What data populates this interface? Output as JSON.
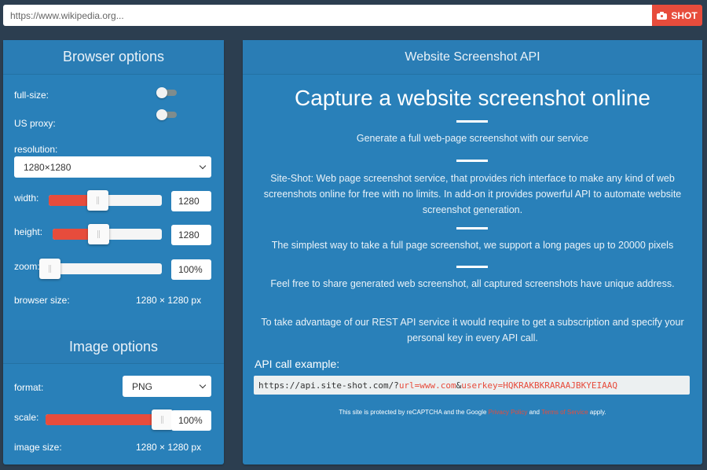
{
  "topbar": {
    "url_placeholder": "https://www.wikipedia.org...",
    "url_value": "",
    "shot_label": "SHOT",
    "shot_icon": "camera-icon"
  },
  "browser_options": {
    "title": "Browser options",
    "full_size": {
      "label": "full-size:",
      "on": false
    },
    "us_proxy": {
      "label": "US proxy:",
      "on": false
    },
    "resolution": {
      "label": "resolution:",
      "selected": "1280×1280"
    },
    "width": {
      "label": "width:",
      "value": "1280",
      "slider_fraction": 0.42
    },
    "height": {
      "label": "height:",
      "value": "1280",
      "slider_fraction": 0.4
    },
    "zoom": {
      "label": "zoom:",
      "value": "100%",
      "slider_fraction": 0.0
    },
    "browser_size": {
      "label": "browser size:",
      "value": "1280 × 1280 px"
    }
  },
  "image_options": {
    "title": "Image options",
    "format": {
      "label": "format:",
      "selected": "PNG"
    },
    "scale": {
      "label": "scale:",
      "value": "100%",
      "slider_fraction": 1.0
    },
    "image_size": {
      "label": "image size:",
      "value": "1280 × 1280 px"
    }
  },
  "api_panel": {
    "title": "Website Screenshot API",
    "hero": "Capture a website screenshot online",
    "p1": "Generate a full web-page screenshot with our service",
    "p2": "Site-Shot: Web page screenshot service, that provides rich interface to make any kind of web screenshots online for free with no limits. In add-on it provides powerful API to automate website screenshot generation.",
    "p3": "The simplest way to take a full page screenshot, we support a long pages up to 20000 pixels",
    "p4": "Feel free to share generated web screenshot, all captured screenshots have unique address.",
    "p5": "To take advantage of our REST API service it would require to get a subscription and specify your personal key in every API call.",
    "api_label": "API call example:",
    "api_base": "https://api.site-shot.com/?",
    "api_param1": "url=www.com",
    "api_amp": "&",
    "api_param2": "userkey=HQKRAKBKRARAAJBKYEIAAQ",
    "recaptcha_pre": "This site is protected by reCAPTCHA and the Google ",
    "privacy_link": "Privacy Policy",
    "recaptcha_and": " and ",
    "terms_link": "Terms of Service",
    "recaptcha_post": " apply."
  },
  "colors": {
    "background": "#2c3e50",
    "panel": "#2980b9",
    "accent": "#e74c3c"
  }
}
